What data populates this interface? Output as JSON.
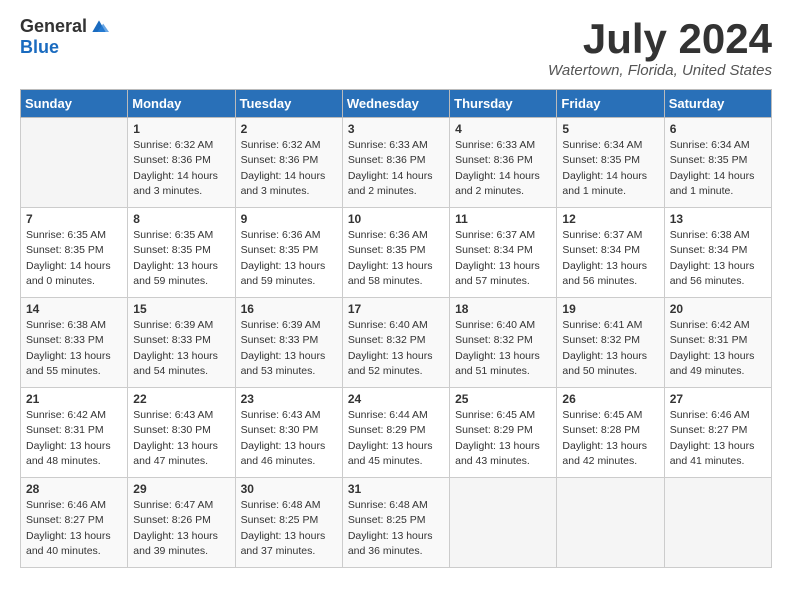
{
  "header": {
    "logo_general": "General",
    "logo_blue": "Blue",
    "month_title": "July 2024",
    "location": "Watertown, Florida, United States"
  },
  "days_of_week": [
    "Sunday",
    "Monday",
    "Tuesday",
    "Wednesday",
    "Thursday",
    "Friday",
    "Saturday"
  ],
  "weeks": [
    [
      {
        "day": "",
        "info": ""
      },
      {
        "day": "1",
        "info": "Sunrise: 6:32 AM\nSunset: 8:36 PM\nDaylight: 14 hours\nand 3 minutes."
      },
      {
        "day": "2",
        "info": "Sunrise: 6:32 AM\nSunset: 8:36 PM\nDaylight: 14 hours\nand 3 minutes."
      },
      {
        "day": "3",
        "info": "Sunrise: 6:33 AM\nSunset: 8:36 PM\nDaylight: 14 hours\nand 2 minutes."
      },
      {
        "day": "4",
        "info": "Sunrise: 6:33 AM\nSunset: 8:36 PM\nDaylight: 14 hours\nand 2 minutes."
      },
      {
        "day": "5",
        "info": "Sunrise: 6:34 AM\nSunset: 8:35 PM\nDaylight: 14 hours\nand 1 minute."
      },
      {
        "day": "6",
        "info": "Sunrise: 6:34 AM\nSunset: 8:35 PM\nDaylight: 14 hours\nand 1 minute."
      }
    ],
    [
      {
        "day": "7",
        "info": "Sunrise: 6:35 AM\nSunset: 8:35 PM\nDaylight: 14 hours\nand 0 minutes."
      },
      {
        "day": "8",
        "info": "Sunrise: 6:35 AM\nSunset: 8:35 PM\nDaylight: 13 hours\nand 59 minutes."
      },
      {
        "day": "9",
        "info": "Sunrise: 6:36 AM\nSunset: 8:35 PM\nDaylight: 13 hours\nand 59 minutes."
      },
      {
        "day": "10",
        "info": "Sunrise: 6:36 AM\nSunset: 8:35 PM\nDaylight: 13 hours\nand 58 minutes."
      },
      {
        "day": "11",
        "info": "Sunrise: 6:37 AM\nSunset: 8:34 PM\nDaylight: 13 hours\nand 57 minutes."
      },
      {
        "day": "12",
        "info": "Sunrise: 6:37 AM\nSunset: 8:34 PM\nDaylight: 13 hours\nand 56 minutes."
      },
      {
        "day": "13",
        "info": "Sunrise: 6:38 AM\nSunset: 8:34 PM\nDaylight: 13 hours\nand 56 minutes."
      }
    ],
    [
      {
        "day": "14",
        "info": "Sunrise: 6:38 AM\nSunset: 8:33 PM\nDaylight: 13 hours\nand 55 minutes."
      },
      {
        "day": "15",
        "info": "Sunrise: 6:39 AM\nSunset: 8:33 PM\nDaylight: 13 hours\nand 54 minutes."
      },
      {
        "day": "16",
        "info": "Sunrise: 6:39 AM\nSunset: 8:33 PM\nDaylight: 13 hours\nand 53 minutes."
      },
      {
        "day": "17",
        "info": "Sunrise: 6:40 AM\nSunset: 8:32 PM\nDaylight: 13 hours\nand 52 minutes."
      },
      {
        "day": "18",
        "info": "Sunrise: 6:40 AM\nSunset: 8:32 PM\nDaylight: 13 hours\nand 51 minutes."
      },
      {
        "day": "19",
        "info": "Sunrise: 6:41 AM\nSunset: 8:32 PM\nDaylight: 13 hours\nand 50 minutes."
      },
      {
        "day": "20",
        "info": "Sunrise: 6:42 AM\nSunset: 8:31 PM\nDaylight: 13 hours\nand 49 minutes."
      }
    ],
    [
      {
        "day": "21",
        "info": "Sunrise: 6:42 AM\nSunset: 8:31 PM\nDaylight: 13 hours\nand 48 minutes."
      },
      {
        "day": "22",
        "info": "Sunrise: 6:43 AM\nSunset: 8:30 PM\nDaylight: 13 hours\nand 47 minutes."
      },
      {
        "day": "23",
        "info": "Sunrise: 6:43 AM\nSunset: 8:30 PM\nDaylight: 13 hours\nand 46 minutes."
      },
      {
        "day": "24",
        "info": "Sunrise: 6:44 AM\nSunset: 8:29 PM\nDaylight: 13 hours\nand 45 minutes."
      },
      {
        "day": "25",
        "info": "Sunrise: 6:45 AM\nSunset: 8:29 PM\nDaylight: 13 hours\nand 43 minutes."
      },
      {
        "day": "26",
        "info": "Sunrise: 6:45 AM\nSunset: 8:28 PM\nDaylight: 13 hours\nand 42 minutes."
      },
      {
        "day": "27",
        "info": "Sunrise: 6:46 AM\nSunset: 8:27 PM\nDaylight: 13 hours\nand 41 minutes."
      }
    ],
    [
      {
        "day": "28",
        "info": "Sunrise: 6:46 AM\nSunset: 8:27 PM\nDaylight: 13 hours\nand 40 minutes."
      },
      {
        "day": "29",
        "info": "Sunrise: 6:47 AM\nSunset: 8:26 PM\nDaylight: 13 hours\nand 39 minutes."
      },
      {
        "day": "30",
        "info": "Sunrise: 6:48 AM\nSunset: 8:25 PM\nDaylight: 13 hours\nand 37 minutes."
      },
      {
        "day": "31",
        "info": "Sunrise: 6:48 AM\nSunset: 8:25 PM\nDaylight: 13 hours\nand 36 minutes."
      },
      {
        "day": "",
        "info": ""
      },
      {
        "day": "",
        "info": ""
      },
      {
        "day": "",
        "info": ""
      }
    ]
  ]
}
